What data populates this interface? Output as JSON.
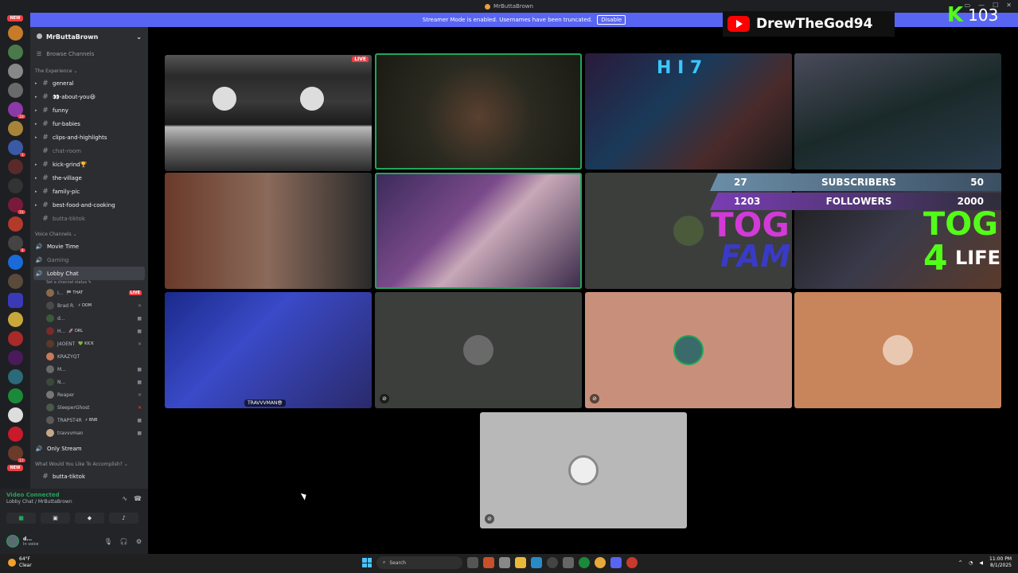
{
  "window": {
    "title": "MrButtaBrown",
    "controls": [
      "▭",
      "—",
      "☐",
      "✕"
    ]
  },
  "banner": {
    "message": "Streamer Mode is enabled. Usernames have been truncated.",
    "disable_label": "Disable"
  },
  "rail": {
    "new_label": "NEW",
    "new_label_bottom": "NEW",
    "badges": [
      "23",
      "1",
      "71",
      "4",
      "17"
    ]
  },
  "server": {
    "name": "MrButtaBrown",
    "browse_label": "Browse Channels"
  },
  "categories": {
    "experience": "The Experience",
    "voice": "Voice Channels",
    "accomplish": "What Would You Like To Accomplish?"
  },
  "text_channels": [
    {
      "name": "general"
    },
    {
      "name": "👀-about-you😃"
    },
    {
      "name": "funny"
    },
    {
      "name": "fur-babies"
    },
    {
      "name": "clips-and-highlights"
    },
    {
      "name": "chat-room"
    },
    {
      "name": "kick-grind🏆"
    },
    {
      "name": "the-village"
    },
    {
      "name": "family-pic"
    },
    {
      "name": "best-food-and-cooking"
    },
    {
      "name": "butta-tiktok"
    }
  ],
  "voice_channels": {
    "movie_time": "Movie Time",
    "gaming": "Gaming",
    "lobby": "Lobby Chat",
    "lobby_status": "Set a channel status ✎",
    "only_stream": "Only Stream",
    "partial": "butta-tiktok"
  },
  "voice_users": [
    {
      "name": "I...",
      "tag": "🏁 THAT",
      "live": "LIVE"
    },
    {
      "name": "Brad R.",
      "tag": "⚡ DOM"
    },
    {
      "name": "d...",
      "tag": ""
    },
    {
      "name": "H...",
      "tag": "🚀 DRL"
    },
    {
      "name": "J4OENT",
      "tag": "💚 KICK"
    },
    {
      "name": "KRAZYQT",
      "tag": ""
    },
    {
      "name": "M...",
      "tag": ""
    },
    {
      "name": "N...",
      "tag": ""
    },
    {
      "name": "Reaper",
      "tag": ""
    },
    {
      "name": "SleeperGhost",
      "tag": ""
    },
    {
      "name": "TRAPST4R",
      "tag": "⚡ BNB"
    },
    {
      "name": "travvvman",
      "tag": ""
    }
  ],
  "voice_panel": {
    "status": "Video Connected",
    "location": "Lobby Chat / MrButtaBrown"
  },
  "user_panel": {
    "name": "d...",
    "status": "In voice"
  },
  "grid": {
    "live_label": "LIVE",
    "nameplate": "TRAVVVMAN😎"
  },
  "overlays": {
    "youtube_name": "DrewTheGod94",
    "kick_letter": "K",
    "kick_count": "103",
    "subscribers_label": "SUBSCRIBERS",
    "subscribers_value": "27",
    "subscribers_goal": "50",
    "followers_label": "FOLLOWERS",
    "followers_value": "1203",
    "followers_goal": "2000",
    "tog": "TOG",
    "fam": "FAM",
    "tog2": "TOG",
    "four": "4",
    "life": "LIFE"
  },
  "taskbar": {
    "weather_temp": "64°F",
    "weather_desc": "Clear",
    "search_label": "Search",
    "time": "11:00 PM",
    "date": "8/1/2025"
  },
  "colors": {
    "accent": "#5865f2",
    "online": "#23a55a",
    "live": "#f23f43",
    "kick": "#53fc18"
  }
}
